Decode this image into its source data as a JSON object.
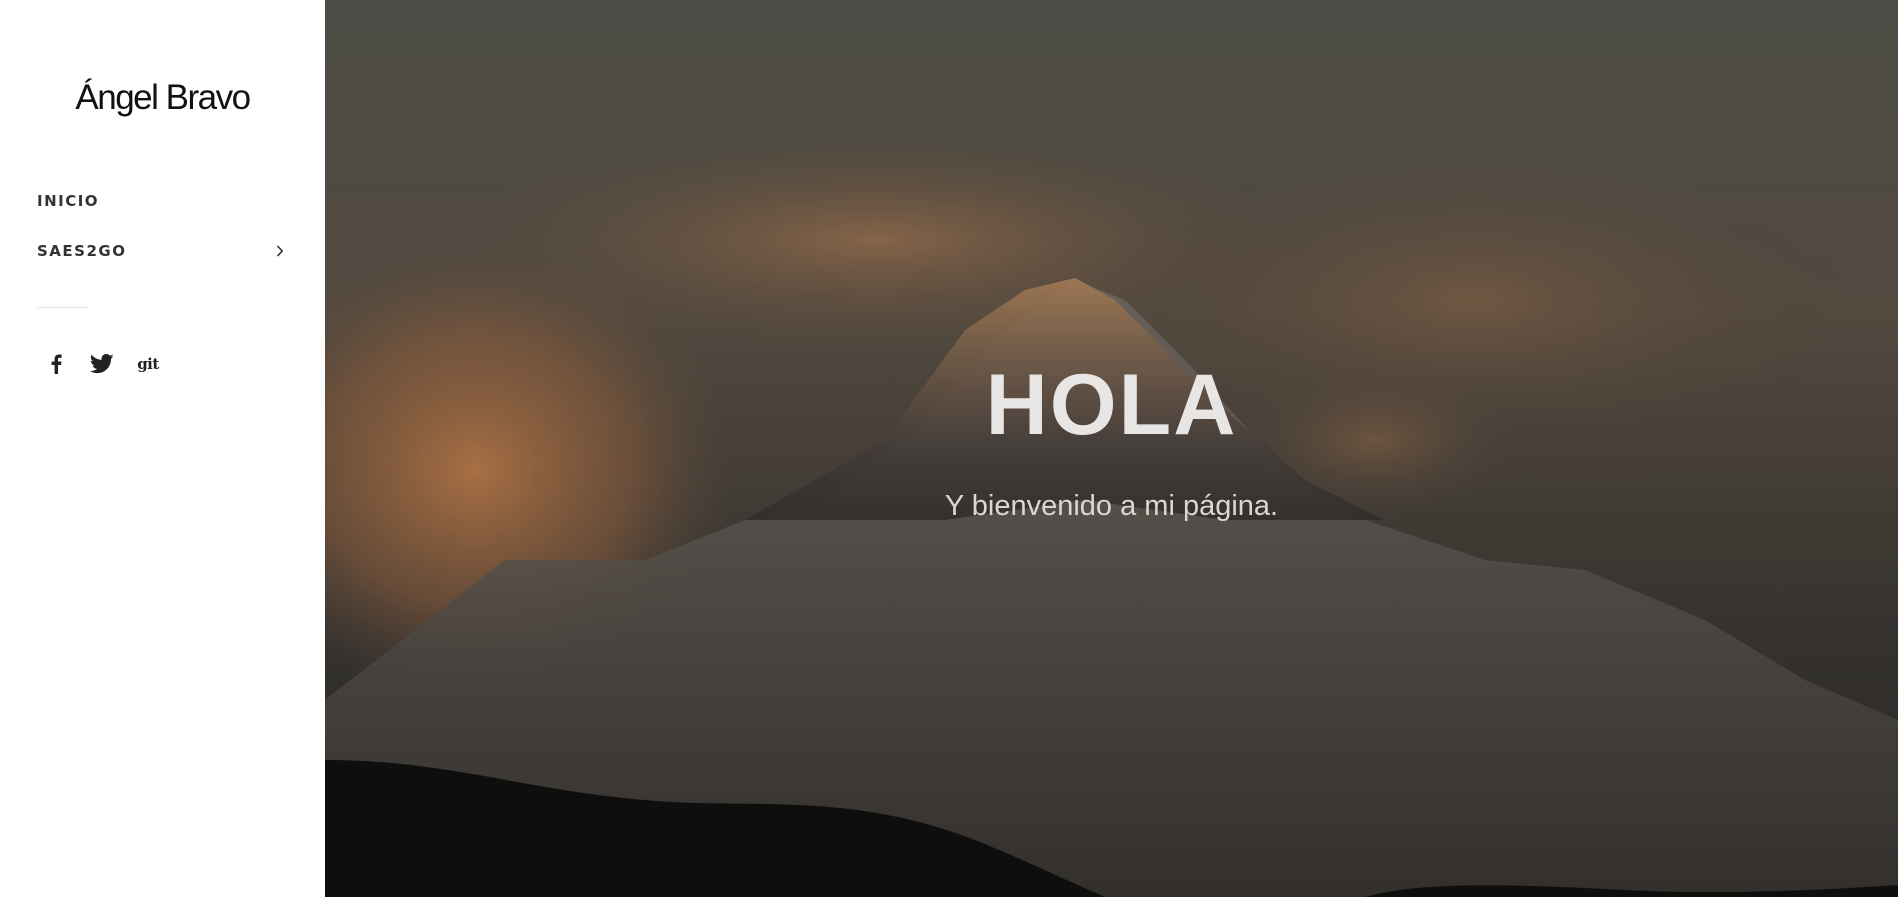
{
  "site": {
    "logo_text": "Ángel Bravo"
  },
  "nav": {
    "items": [
      {
        "label": "INICIO",
        "has_submenu": false
      },
      {
        "label": "SAES2GO",
        "has_submenu": true
      }
    ]
  },
  "social": {
    "items": [
      {
        "icon": "facebook-icon"
      },
      {
        "icon": "twitter-icon"
      },
      {
        "icon": "git-icon",
        "label": "git"
      }
    ]
  },
  "hero": {
    "title": "HOLA",
    "subtitle": "Y bienvenido a mi página."
  },
  "colors": {
    "sidebar_bg": "#ffffff",
    "nav_text": "#333333",
    "hero_title": "#e8e6e4",
    "hero_overlay": "#3b3a36"
  }
}
